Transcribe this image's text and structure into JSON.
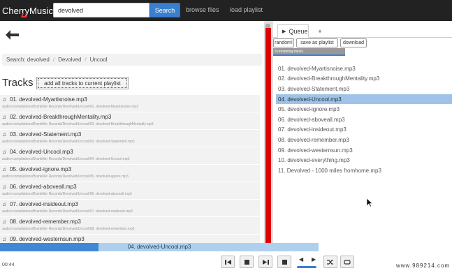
{
  "app": {
    "name": "CherryMusic"
  },
  "nav": {
    "search_value": "devolved",
    "search_button": "Search",
    "browse_files": "browse files",
    "load_playlist": "load playlist"
  },
  "left": {
    "breadcrumb": [
      "Search: devolved",
      "Devolved",
      "Uncool"
    ],
    "tracks_title": "Tracks",
    "add_all_label": "add all tracks to current playlist",
    "tracks": [
      {
        "name": "01. devolved-Myartisnoise.mp3",
        "path": "audio>compilations/Brankiller Records/Devolved/Uncool/01. devolved-Myartisnoise.mp3"
      },
      {
        "name": "02. devolved-BreakthroughMentality.mp3",
        "path": "audio>compilations/Brankiller Records/Devolved/Uncool/02. devolved-BreakthroughMentality.mp3"
      },
      {
        "name": "03. devolved-Statement.mp3",
        "path": "audio>compilations/Brankiller Records/Devolved/Uncool/03. devolved-Statement.mp3"
      },
      {
        "name": "04. devolved-Uncool.mp3",
        "path": "audio>compilations/Brankiller Records/Devolved/Uncool/04. devolved-Uncool.mp3"
      },
      {
        "name": "05. devolved-ignore.mp3",
        "path": "audio>compilations/Brankiller Records/Devolved/Uncool/05. devolved-ignore.mp3"
      },
      {
        "name": "06. devolved-aboveall.mp3",
        "path": "audio>compilations/Brankiller Records/Devolved/Uncool/06. devolved-aboveall.mp3"
      },
      {
        "name": "07. devolved-insideout.mp3",
        "path": "audio>compilations/Brankiller Records/Devolved/Uncool/07. devolved-insideout.mp3"
      },
      {
        "name": "08. devolved-remember.mp3",
        "path": "audio>compilations/Brankiller Records/Devolved/Uncool/08. devolved-remember.mp3"
      },
      {
        "name": "09. devolved-westernsun.mp3",
        "path": "audio>compilations/Brankiller Records/Devolved/Uncool/09. devolved-westernsun.mp3"
      }
    ]
  },
  "right": {
    "tab_queue": "Queue",
    "tab_add": "+",
    "random_btn": "random!",
    "save_btn": "save as playlist",
    "download_btn": "download",
    "remaining": "9 remaining tracks",
    "queue": [
      "01. devolved-Myartisnoise.mp3",
      "02. devolved-BreakthroughMentality.mp3",
      "03. devolved-Statement.mp3",
      "04. devolved-Uncool.mp3",
      "05. devolved-ignore.mp3",
      "06. devolved-aboveall.mp3",
      "07. devolved-insideout.mp3",
      "08. devolved-remember.mp3",
      "09. devolved-westernsun.mp3",
      "10. devolved-everything.mp3",
      "11. Devolved - 1000 miles fromhome.mp3"
    ],
    "current_index": 3
  },
  "player": {
    "now_playing": "04. devolved-Uncool.mp3",
    "time": "00:44",
    "progress_fraction": 0.31
  },
  "watermark": "www.989214.com",
  "colors": {
    "accent": "#3a7fcf",
    "divider_red": "#d00000",
    "navbar": "#222222"
  }
}
